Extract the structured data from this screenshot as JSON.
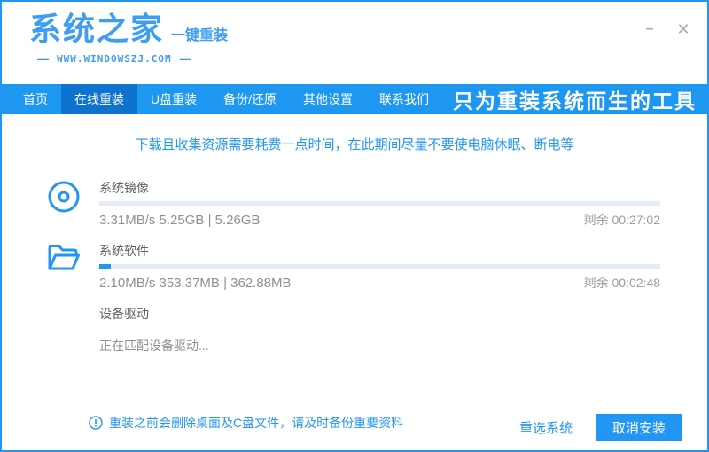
{
  "window": {
    "minimize_glyph": "–",
    "close_glyph": "✕"
  },
  "header": {
    "logo_text": "系统之家",
    "logo_sub": "一键重装",
    "website": "WWW.WINDOWSZJ.COM",
    "dash": "—"
  },
  "nav": {
    "items": [
      {
        "label": "首页",
        "active": false
      },
      {
        "label": "在线重装",
        "active": true
      },
      {
        "label": "U盘重装",
        "active": false
      },
      {
        "label": "备份/还原",
        "active": false
      },
      {
        "label": "其他设置",
        "active": false
      },
      {
        "label": "联系我们",
        "active": false
      }
    ],
    "slogan": "只为重装系统而生的工具"
  },
  "main": {
    "notice": "下载且收集资源需要耗费一点时间，在此期间尽量不要使电脑休眠、断电等",
    "tasks": [
      {
        "name": "系统镜像",
        "icon": "disc-icon",
        "progress_percent": 0,
        "stats": "3.31MB/s 5.25GB | 5.26GB",
        "remaining": "剩余 00:27:02"
      },
      {
        "name": "系统软件",
        "icon": "folder-icon",
        "progress_percent": 2,
        "stats": "2.10MB/s 353.37MB | 362.88MB",
        "remaining": "剩余 00:02:48"
      },
      {
        "name": "设备驱动",
        "icon": "none",
        "status": "正在匹配设备驱动..."
      }
    ],
    "warning": "重装之前会删除桌面及C盘文件，请及时备份重要资料"
  },
  "footer": {
    "reselect_label": "重选系统",
    "cancel_label": "取消安装"
  },
  "colors": {
    "accent": "#2196f3",
    "nav_bg": "#1e97f0",
    "nav_active_bg": "#0e72cf",
    "progress_track": "#e5ecf6",
    "stats_text": "#8b9196"
  }
}
